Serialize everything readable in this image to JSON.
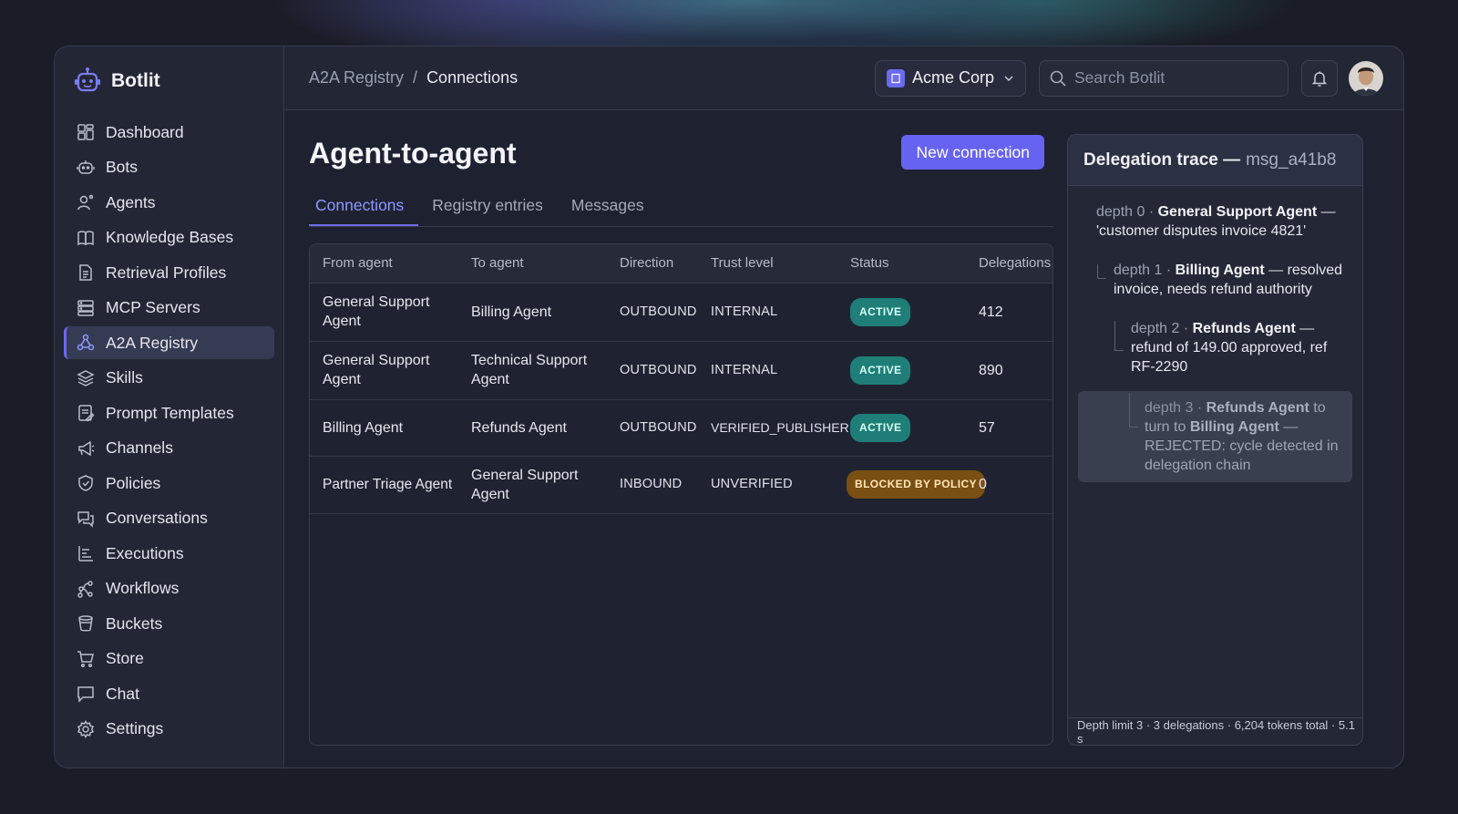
{
  "app": {
    "name": "Botlit"
  },
  "sidebar": {
    "items": [
      {
        "label": "Dashboard",
        "icon": "dashboard-icon"
      },
      {
        "label": "Bots",
        "icon": "bot-icon"
      },
      {
        "label": "Agents",
        "icon": "agents-icon"
      },
      {
        "label": "Knowledge Bases",
        "icon": "book-icon"
      },
      {
        "label": "Retrieval Profiles",
        "icon": "document-icon"
      },
      {
        "label": "MCP Servers",
        "icon": "server-icon"
      },
      {
        "label": "A2A Registry",
        "icon": "network-icon",
        "active": true
      },
      {
        "label": "Skills",
        "icon": "layers-icon"
      },
      {
        "label": "Prompt Templates",
        "icon": "template-icon"
      },
      {
        "label": "Channels",
        "icon": "megaphone-icon"
      },
      {
        "label": "Policies",
        "icon": "shield-icon"
      },
      {
        "label": "Conversations",
        "icon": "chat-bubbles-icon"
      },
      {
        "label": "Executions",
        "icon": "list-icon"
      },
      {
        "label": "Workflows",
        "icon": "workflow-icon"
      },
      {
        "label": "Buckets",
        "icon": "bucket-icon"
      },
      {
        "label": "Store",
        "icon": "cart-icon"
      },
      {
        "label": "Chat",
        "icon": "chat-icon"
      },
      {
        "label": "Settings",
        "icon": "gear-icon"
      }
    ]
  },
  "topbar": {
    "breadcrumb": [
      "A2A Registry",
      "Connections"
    ],
    "workspace": "Acme Corp",
    "search_placeholder": "Search Botlit"
  },
  "page": {
    "title": "Agent-to-agent",
    "new_button": "New connection",
    "tabs": [
      "Connections",
      "Registry entries",
      "Messages"
    ],
    "active_tab": 0
  },
  "table": {
    "columns": [
      "From agent",
      "To agent",
      "Direction",
      "Trust level",
      "Status",
      "Delegations"
    ],
    "rows": [
      {
        "from": "General Support Agent",
        "to": "Billing Agent",
        "direction": "OUTBOUND",
        "trust": "INTERNAL",
        "status": "ACTIVE",
        "delegations": "412"
      },
      {
        "from": "General Support Agent",
        "to": "Technical Support Agent",
        "direction": "OUTBOUND",
        "trust": "INTERNAL",
        "status": "ACTIVE",
        "delegations": "890"
      },
      {
        "from": "Billing Agent",
        "to": "Refunds Agent",
        "direction": "OUTBOUND",
        "trust": "VERIFIED_PUBLISHER",
        "status": "ACTIVE",
        "delegations": "57"
      },
      {
        "from": "Partner Triage Agent",
        "to": "General Support Agent",
        "direction": "INBOUND",
        "trust": "UNVERIFIED",
        "status": "BLOCKED BY POLICY",
        "delegations": "0"
      }
    ]
  },
  "trace": {
    "title": "Delegation trace —",
    "msg_id": "msg_a41b8",
    "steps": [
      {
        "depth": "depth 0 ·",
        "agent": "General Support Agent",
        "text": "— 'customer disputes invoice 4821'"
      },
      {
        "depth": "depth 1 ·",
        "agent": "Billing Agent",
        "text": "— resolved invoice, needs refund authority"
      },
      {
        "depth": "depth 2 ·",
        "agent": "Refunds Agent",
        "text": "— refund of 149.00 approved, ref RF-2290"
      },
      {
        "depth": "depth 3 ·",
        "agent": "Refunds Agent",
        "mid": "to turn to",
        "agent2": "Billing Agent",
        "text": "— REJECTED: cycle detected in delegation chain"
      }
    ],
    "footer": "Depth limit 3 · 3 delegations · 6,204 tokens total · 5.1 s"
  },
  "colors": {
    "accent": "#6763f2",
    "active_badge": "#1f7f78",
    "blocked_badge": "#7a4f12"
  }
}
